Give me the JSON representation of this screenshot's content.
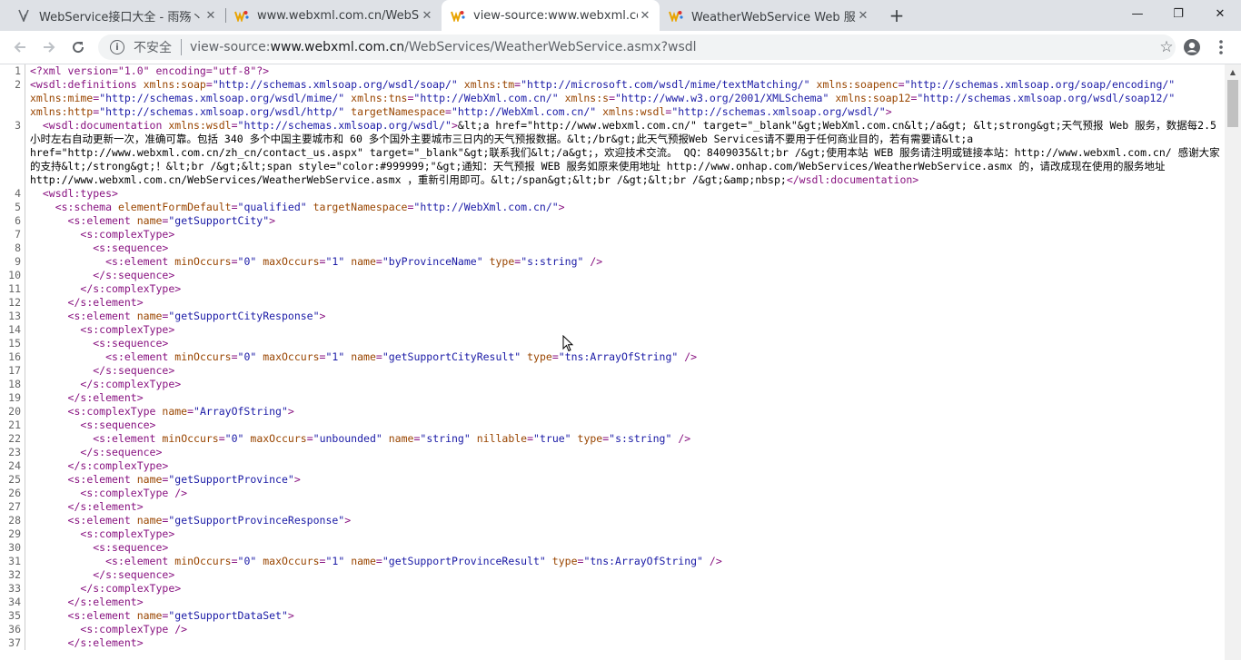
{
  "tabs": [
    {
      "title": "WebService接口大全 - 雨殇丶 -",
      "icon": "document-icon"
    },
    {
      "title": "www.webxml.com.cn/WebServ",
      "icon": "webxml-icon"
    },
    {
      "title": "view-source:www.webxml.com.",
      "icon": "webxml-icon"
    },
    {
      "title": "WeatherWebService Web 服务",
      "icon": "webxml-icon"
    }
  ],
  "new_tab_label": "+",
  "window": {
    "minimize": "—",
    "restore": "❐",
    "close": "✕"
  },
  "toolbar": {
    "security_label": "不安全",
    "url_prefix": "view-source:",
    "url_host": "www.webxml.com.cn",
    "url_path": "/WebServices/WeatherWebService.asmx?wsdl"
  },
  "colors": {
    "tag": "#881280",
    "attr": "#994500",
    "value": "#1a1aa6"
  },
  "source_lines": [
    {
      "n": "1",
      "segs": [
        {
          "c": "t",
          "s": "<?xml version=\"1.0\" encoding=\"utf-8\"?>"
        }
      ]
    },
    {
      "n": "2",
      "segs": [
        {
          "c": "t",
          "s": "<wsdl:definitions "
        },
        {
          "c": "a",
          "s": "xmlns:soap"
        },
        {
          "c": "t",
          "s": "="
        },
        {
          "c": "v",
          "s": "\"http://schemas.xmlsoap.org/wsdl/soap/\""
        },
        {
          "c": "t",
          "s": " "
        },
        {
          "c": "a",
          "s": "xmlns:tm"
        },
        {
          "c": "t",
          "s": "="
        },
        {
          "c": "v",
          "s": "\"http://microsoft.com/wsdl/mime/textMatching/\""
        },
        {
          "c": "t",
          "s": " "
        },
        {
          "c": "a",
          "s": "xmlns:soapenc"
        },
        {
          "c": "t",
          "s": "="
        },
        {
          "c": "v",
          "s": "\"http://schemas.xmlsoap.org/soap/encoding/\""
        },
        {
          "c": "t",
          "s": " "
        },
        {
          "c": "a",
          "s": "xmlns:mime"
        },
        {
          "c": "t",
          "s": "="
        },
        {
          "c": "v",
          "s": "\"http://schemas.xmlsoap.org/wsdl/mime/\""
        },
        {
          "c": "t",
          "s": " "
        },
        {
          "c": "a",
          "s": "xmlns:tns"
        },
        {
          "c": "t",
          "s": "="
        },
        {
          "c": "v",
          "s": "\"http://WebXml.com.cn/\""
        },
        {
          "c": "t",
          "s": " "
        },
        {
          "c": "a",
          "s": "xmlns:s"
        },
        {
          "c": "t",
          "s": "="
        },
        {
          "c": "v",
          "s": "\"http://www.w3.org/2001/XMLSchema\""
        },
        {
          "c": "t",
          "s": " "
        },
        {
          "c": "a",
          "s": "xmlns:soap12"
        },
        {
          "c": "t",
          "s": "="
        },
        {
          "c": "v",
          "s": "\"http://schemas.xmlsoap.org/wsdl/soap12/\""
        },
        {
          "c": "t",
          "s": " "
        },
        {
          "c": "a",
          "s": "xmlns:http"
        },
        {
          "c": "t",
          "s": "="
        },
        {
          "c": "v",
          "s": "\"http://schemas.xmlsoap.org/wsdl/http/\""
        },
        {
          "c": "t",
          "s": " "
        },
        {
          "c": "a",
          "s": "targetNamespace"
        },
        {
          "c": "t",
          "s": "="
        },
        {
          "c": "v",
          "s": "\"http://WebXml.com.cn/\""
        },
        {
          "c": "t",
          "s": " "
        },
        {
          "c": "a",
          "s": "xmlns:wsdl"
        },
        {
          "c": "t",
          "s": "="
        },
        {
          "c": "v",
          "s": "\"http://schemas.xmlsoap.org/wsdl/\""
        },
        {
          "c": "t",
          "s": ">"
        }
      ]
    },
    {
      "n": "3",
      "segs": [
        {
          "c": "",
          "s": "  "
        },
        {
          "c": "t",
          "s": "<wsdl:documentation "
        },
        {
          "c": "a",
          "s": "xmlns:wsdl"
        },
        {
          "c": "t",
          "s": "="
        },
        {
          "c": "v",
          "s": "\"http://schemas.xmlsoap.org/wsdl/\""
        },
        {
          "c": "t",
          "s": ">"
        },
        {
          "c": "",
          "s": "&lt;a href=\"http://www.webxml.com.cn/\" target=\"_blank\"&gt;WebXml.com.cn&lt;/a&gt; &lt;strong&gt;天气预报 Web 服务，数据每2.5小时左右自动更新一次，准确可靠。包括 340 多个中国主要城市和 60 多个国外主要城市三日内的天气预报数据。&lt;/br&gt;此天气预报Web Services请不要用于任何商业目的，若有需要请&lt;a href=\"http://www.webxml.com.cn/zh_cn/contact_us.aspx\" target=\"_blank\"&gt;联系我们&lt;/a&gt;，欢迎技术交流。 QQ：8409035&lt;br /&gt;使用本站 WEB 服务请注明或链接本站：http://www.webxml.com.cn/ 感谢大家的支持&lt;/strong&gt;！&lt;br /&gt;&lt;span style=\"color:#999999;\"&gt;通知：天气预报 WEB 服务如原来使用地址 http://www.onhap.com/WebServices/WeatherWebService.asmx 的，请改成现在使用的服务地址 http://www.webxml.com.cn/WebServices/WeatherWebService.asmx ，重新引用即可。&lt;/span&gt;&lt;br /&gt;&lt;br /&gt;&amp;nbsp;"
        },
        {
          "c": "t",
          "s": "</wsdl:documentation>"
        }
      ]
    },
    {
      "n": "4",
      "segs": [
        {
          "c": "",
          "s": "  "
        },
        {
          "c": "t",
          "s": "<wsdl:types>"
        }
      ]
    },
    {
      "n": "5",
      "segs": [
        {
          "c": "",
          "s": "    "
        },
        {
          "c": "t",
          "s": "<s:schema "
        },
        {
          "c": "a",
          "s": "elementFormDefault"
        },
        {
          "c": "t",
          "s": "="
        },
        {
          "c": "v",
          "s": "\"qualified\""
        },
        {
          "c": "t",
          "s": " "
        },
        {
          "c": "a",
          "s": "targetNamespace"
        },
        {
          "c": "t",
          "s": "="
        },
        {
          "c": "v",
          "s": "\"http://WebXml.com.cn/\""
        },
        {
          "c": "t",
          "s": ">"
        }
      ]
    },
    {
      "n": "6",
      "segs": [
        {
          "c": "",
          "s": "      "
        },
        {
          "c": "t",
          "s": "<s:element "
        },
        {
          "c": "a",
          "s": "name"
        },
        {
          "c": "t",
          "s": "="
        },
        {
          "c": "v",
          "s": "\"getSupportCity\""
        },
        {
          "c": "t",
          "s": ">"
        }
      ]
    },
    {
      "n": "7",
      "segs": [
        {
          "c": "",
          "s": "        "
        },
        {
          "c": "t",
          "s": "<s:complexType>"
        }
      ]
    },
    {
      "n": "8",
      "segs": [
        {
          "c": "",
          "s": "          "
        },
        {
          "c": "t",
          "s": "<s:sequence>"
        }
      ]
    },
    {
      "n": "9",
      "segs": [
        {
          "c": "",
          "s": "            "
        },
        {
          "c": "t",
          "s": "<s:element "
        },
        {
          "c": "a",
          "s": "minOccurs"
        },
        {
          "c": "t",
          "s": "="
        },
        {
          "c": "v",
          "s": "\"0\""
        },
        {
          "c": "t",
          "s": " "
        },
        {
          "c": "a",
          "s": "maxOccurs"
        },
        {
          "c": "t",
          "s": "="
        },
        {
          "c": "v",
          "s": "\"1\""
        },
        {
          "c": "t",
          "s": " "
        },
        {
          "c": "a",
          "s": "name"
        },
        {
          "c": "t",
          "s": "="
        },
        {
          "c": "v",
          "s": "\"byProvinceName\""
        },
        {
          "c": "t",
          "s": " "
        },
        {
          "c": "a",
          "s": "type"
        },
        {
          "c": "t",
          "s": "="
        },
        {
          "c": "v",
          "s": "\"s:string\""
        },
        {
          "c": "t",
          "s": " />"
        }
      ]
    },
    {
      "n": "10",
      "segs": [
        {
          "c": "",
          "s": "          "
        },
        {
          "c": "t",
          "s": "</s:sequence>"
        }
      ]
    },
    {
      "n": "11",
      "segs": [
        {
          "c": "",
          "s": "        "
        },
        {
          "c": "t",
          "s": "</s:complexType>"
        }
      ]
    },
    {
      "n": "12",
      "segs": [
        {
          "c": "",
          "s": "      "
        },
        {
          "c": "t",
          "s": "</s:element>"
        }
      ]
    },
    {
      "n": "13",
      "segs": [
        {
          "c": "",
          "s": "      "
        },
        {
          "c": "t",
          "s": "<s:element "
        },
        {
          "c": "a",
          "s": "name"
        },
        {
          "c": "t",
          "s": "="
        },
        {
          "c": "v",
          "s": "\"getSupportCityResponse\""
        },
        {
          "c": "t",
          "s": ">"
        }
      ]
    },
    {
      "n": "14",
      "segs": [
        {
          "c": "",
          "s": "        "
        },
        {
          "c": "t",
          "s": "<s:complexType>"
        }
      ]
    },
    {
      "n": "15",
      "segs": [
        {
          "c": "",
          "s": "          "
        },
        {
          "c": "t",
          "s": "<s:sequence>"
        }
      ]
    },
    {
      "n": "16",
      "segs": [
        {
          "c": "",
          "s": "            "
        },
        {
          "c": "t",
          "s": "<s:element "
        },
        {
          "c": "a",
          "s": "minOccurs"
        },
        {
          "c": "t",
          "s": "="
        },
        {
          "c": "v",
          "s": "\"0\""
        },
        {
          "c": "t",
          "s": " "
        },
        {
          "c": "a",
          "s": "maxOccurs"
        },
        {
          "c": "t",
          "s": "="
        },
        {
          "c": "v",
          "s": "\"1\""
        },
        {
          "c": "t",
          "s": " "
        },
        {
          "c": "a",
          "s": "name"
        },
        {
          "c": "t",
          "s": "="
        },
        {
          "c": "v",
          "s": "\"getSupportCityResult\""
        },
        {
          "c": "t",
          "s": " "
        },
        {
          "c": "a",
          "s": "type"
        },
        {
          "c": "t",
          "s": "="
        },
        {
          "c": "v",
          "s": "\"tns:ArrayOfString\""
        },
        {
          "c": "t",
          "s": " />"
        }
      ]
    },
    {
      "n": "17",
      "segs": [
        {
          "c": "",
          "s": "          "
        },
        {
          "c": "t",
          "s": "</s:sequence>"
        }
      ]
    },
    {
      "n": "18",
      "segs": [
        {
          "c": "",
          "s": "        "
        },
        {
          "c": "t",
          "s": "</s:complexType>"
        }
      ]
    },
    {
      "n": "19",
      "segs": [
        {
          "c": "",
          "s": "      "
        },
        {
          "c": "t",
          "s": "</s:element>"
        }
      ]
    },
    {
      "n": "20",
      "segs": [
        {
          "c": "",
          "s": "      "
        },
        {
          "c": "t",
          "s": "<s:complexType "
        },
        {
          "c": "a",
          "s": "name"
        },
        {
          "c": "t",
          "s": "="
        },
        {
          "c": "v",
          "s": "\"ArrayOfString\""
        },
        {
          "c": "t",
          "s": ">"
        }
      ]
    },
    {
      "n": "21",
      "segs": [
        {
          "c": "",
          "s": "        "
        },
        {
          "c": "t",
          "s": "<s:sequence>"
        }
      ]
    },
    {
      "n": "22",
      "segs": [
        {
          "c": "",
          "s": "          "
        },
        {
          "c": "t",
          "s": "<s:element "
        },
        {
          "c": "a",
          "s": "minOccurs"
        },
        {
          "c": "t",
          "s": "="
        },
        {
          "c": "v",
          "s": "\"0\""
        },
        {
          "c": "t",
          "s": " "
        },
        {
          "c": "a",
          "s": "maxOccurs"
        },
        {
          "c": "t",
          "s": "="
        },
        {
          "c": "v",
          "s": "\"unbounded\""
        },
        {
          "c": "t",
          "s": " "
        },
        {
          "c": "a",
          "s": "name"
        },
        {
          "c": "t",
          "s": "="
        },
        {
          "c": "v",
          "s": "\"string\""
        },
        {
          "c": "t",
          "s": " "
        },
        {
          "c": "a",
          "s": "nillable"
        },
        {
          "c": "t",
          "s": "="
        },
        {
          "c": "v",
          "s": "\"true\""
        },
        {
          "c": "t",
          "s": " "
        },
        {
          "c": "a",
          "s": "type"
        },
        {
          "c": "t",
          "s": "="
        },
        {
          "c": "v",
          "s": "\"s:string\""
        },
        {
          "c": "t",
          "s": " />"
        }
      ]
    },
    {
      "n": "23",
      "segs": [
        {
          "c": "",
          "s": "        "
        },
        {
          "c": "t",
          "s": "</s:sequence>"
        }
      ]
    },
    {
      "n": "24",
      "segs": [
        {
          "c": "",
          "s": "      "
        },
        {
          "c": "t",
          "s": "</s:complexType>"
        }
      ]
    },
    {
      "n": "25",
      "segs": [
        {
          "c": "",
          "s": "      "
        },
        {
          "c": "t",
          "s": "<s:element "
        },
        {
          "c": "a",
          "s": "name"
        },
        {
          "c": "t",
          "s": "="
        },
        {
          "c": "v",
          "s": "\"getSupportProvince\""
        },
        {
          "c": "t",
          "s": ">"
        }
      ]
    },
    {
      "n": "26",
      "segs": [
        {
          "c": "",
          "s": "        "
        },
        {
          "c": "t",
          "s": "<s:complexType />"
        }
      ]
    },
    {
      "n": "27",
      "segs": [
        {
          "c": "",
          "s": "      "
        },
        {
          "c": "t",
          "s": "</s:element>"
        }
      ]
    },
    {
      "n": "28",
      "segs": [
        {
          "c": "",
          "s": "      "
        },
        {
          "c": "t",
          "s": "<s:element "
        },
        {
          "c": "a",
          "s": "name"
        },
        {
          "c": "t",
          "s": "="
        },
        {
          "c": "v",
          "s": "\"getSupportProvinceResponse\""
        },
        {
          "c": "t",
          "s": ">"
        }
      ]
    },
    {
      "n": "29",
      "segs": [
        {
          "c": "",
          "s": "        "
        },
        {
          "c": "t",
          "s": "<s:complexType>"
        }
      ]
    },
    {
      "n": "30",
      "segs": [
        {
          "c": "",
          "s": "          "
        },
        {
          "c": "t",
          "s": "<s:sequence>"
        }
      ]
    },
    {
      "n": "31",
      "segs": [
        {
          "c": "",
          "s": "            "
        },
        {
          "c": "t",
          "s": "<s:element "
        },
        {
          "c": "a",
          "s": "minOccurs"
        },
        {
          "c": "t",
          "s": "="
        },
        {
          "c": "v",
          "s": "\"0\""
        },
        {
          "c": "t",
          "s": " "
        },
        {
          "c": "a",
          "s": "maxOccurs"
        },
        {
          "c": "t",
          "s": "="
        },
        {
          "c": "v",
          "s": "\"1\""
        },
        {
          "c": "t",
          "s": " "
        },
        {
          "c": "a",
          "s": "name"
        },
        {
          "c": "t",
          "s": "="
        },
        {
          "c": "v",
          "s": "\"getSupportProvinceResult\""
        },
        {
          "c": "t",
          "s": " "
        },
        {
          "c": "a",
          "s": "type"
        },
        {
          "c": "t",
          "s": "="
        },
        {
          "c": "v",
          "s": "\"tns:ArrayOfString\""
        },
        {
          "c": "t",
          "s": " />"
        }
      ]
    },
    {
      "n": "32",
      "segs": [
        {
          "c": "",
          "s": "          "
        },
        {
          "c": "t",
          "s": "</s:sequence>"
        }
      ]
    },
    {
      "n": "33",
      "segs": [
        {
          "c": "",
          "s": "        "
        },
        {
          "c": "t",
          "s": "</s:complexType>"
        }
      ]
    },
    {
      "n": "34",
      "segs": [
        {
          "c": "",
          "s": "      "
        },
        {
          "c": "t",
          "s": "</s:element>"
        }
      ]
    },
    {
      "n": "35",
      "segs": [
        {
          "c": "",
          "s": "      "
        },
        {
          "c": "t",
          "s": "<s:element "
        },
        {
          "c": "a",
          "s": "name"
        },
        {
          "c": "t",
          "s": "="
        },
        {
          "c": "v",
          "s": "\"getSupportDataSet\""
        },
        {
          "c": "t",
          "s": ">"
        }
      ]
    },
    {
      "n": "36",
      "segs": [
        {
          "c": "",
          "s": "        "
        },
        {
          "c": "t",
          "s": "<s:complexType />"
        }
      ]
    },
    {
      "n": "37",
      "segs": [
        {
          "c": "",
          "s": "      "
        },
        {
          "c": "t",
          "s": "</s:element>"
        }
      ]
    }
  ]
}
